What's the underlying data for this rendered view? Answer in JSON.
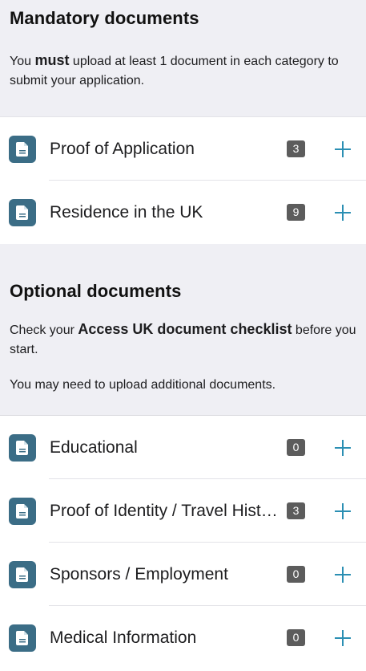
{
  "mandatory": {
    "title": "Mandatory documents",
    "text_before": "You ",
    "text_bold": "must",
    "text_after": " upload at least 1 document in each category to submit your application.",
    "items": [
      {
        "label": "Proof of Application",
        "count": "3",
        "icon": "document-icon",
        "add_icon": "plus-icon"
      },
      {
        "label": "Residence in the UK",
        "count": "9",
        "icon": "document-icon",
        "add_icon": "plus-icon"
      }
    ]
  },
  "optional": {
    "title": "Optional documents",
    "text1_before": "Check your ",
    "text1_bold": "Access UK document checklist",
    "text1_after": " before you start.",
    "text2": "You may need to upload additional documents.",
    "items": [
      {
        "label": "Educational",
        "count": "0",
        "icon": "document-icon",
        "add_icon": "plus-icon"
      },
      {
        "label": "Proof of Identity / Travel History",
        "count": "3",
        "icon": "document-icon",
        "add_icon": "plus-icon"
      },
      {
        "label": "Sponsors / Employment",
        "count": "0",
        "icon": "document-icon",
        "add_icon": "plus-icon"
      },
      {
        "label": "Medical Information",
        "count": "0",
        "icon": "document-icon",
        "add_icon": "plus-icon"
      }
    ]
  },
  "colors": {
    "section_background": "#efeff4",
    "icon_background": "#3b6d86",
    "badge_background": "#5c5c5c",
    "accent_plus": "#2b8fb3"
  }
}
